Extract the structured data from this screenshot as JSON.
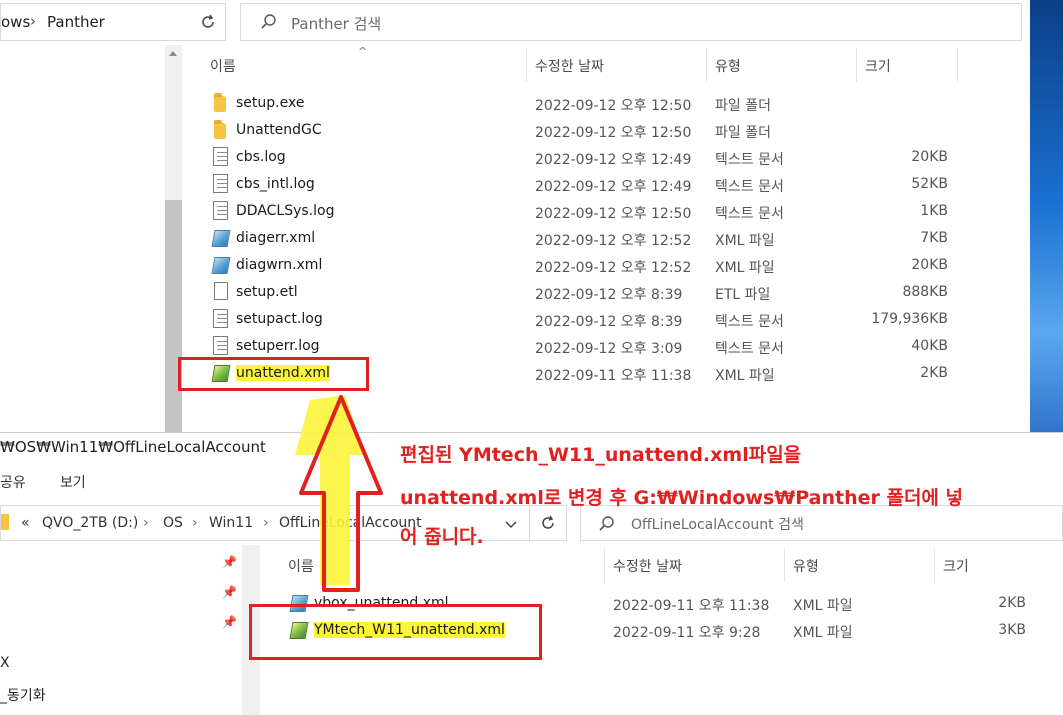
{
  "top_window": {
    "address": {
      "tail": "ows",
      "folder": "Panther"
    },
    "search_placeholder": "Panther 검색",
    "columns": {
      "name": "이름",
      "date": "수정한 날짜",
      "type": "유형",
      "size": "크기"
    },
    "files": [
      {
        "name": "setup.exe",
        "date": "2022-09-12 오후 12:50",
        "type": "파일 폴더",
        "size": "",
        "icon": "folder-icon"
      },
      {
        "name": "UnattendGC",
        "date": "2022-09-12 오후 12:50",
        "type": "파일 폴더",
        "size": "",
        "icon": "folder-icon"
      },
      {
        "name": "cbs.log",
        "date": "2022-09-12 오후 12:49",
        "type": "텍스트 문서",
        "size": "20KB",
        "icon": "text-file-icon"
      },
      {
        "name": "cbs_intl.log",
        "date": "2022-09-12 오후 12:49",
        "type": "텍스트 문서",
        "size": "52KB",
        "icon": "text-file-icon"
      },
      {
        "name": "DDACLSys.log",
        "date": "2022-09-12 오후 12:50",
        "type": "텍스트 문서",
        "size": "1KB",
        "icon": "text-file-icon"
      },
      {
        "name": "diagerr.xml",
        "date": "2022-09-12 오후 12:52",
        "type": "XML 파일",
        "size": "7KB",
        "icon": "xml-file-icon"
      },
      {
        "name": "diagwrn.xml",
        "date": "2022-09-12 오후 12:52",
        "type": "XML 파일",
        "size": "20KB",
        "icon": "xml-file-icon"
      },
      {
        "name": "setup.etl",
        "date": "2022-09-12 오후 8:39",
        "type": "ETL 파일",
        "size": "888KB",
        "icon": "blank-file-icon"
      },
      {
        "name": "setupact.log",
        "date": "2022-09-12 오후 8:39",
        "type": "텍스트 문서",
        "size": "179,936KB",
        "icon": "text-file-icon"
      },
      {
        "name": "setuperr.log",
        "date": "2022-09-12 오후 3:09",
        "type": "텍스트 문서",
        "size": "40KB",
        "icon": "text-file-icon"
      },
      {
        "name": "unattend.xml",
        "date": "2022-09-11 오후 11:38",
        "type": "XML 파일",
        "size": "2KB",
        "icon": "xml-file-icon"
      }
    ]
  },
  "bottom_window": {
    "title": "₩OS₩Win11₩OffLineLocalAccount",
    "menu": {
      "share": "공유",
      "view": "보기"
    },
    "breadcrumb": [
      "«",
      "QVO_2TB (D:)",
      "OS",
      "Win11",
      "OffLineLocalAccount"
    ],
    "search_placeholder": "OffLineLocalAccount 검색",
    "nav_items": [
      "X",
      "_동기화"
    ],
    "columns": {
      "name": "이름",
      "date": "수정한 날짜",
      "type": "유형",
      "size": "크기"
    },
    "files": [
      {
        "name": "vbox_unattend.xml",
        "date": "2022-09-11 오후 11:38",
        "type": "XML 파일",
        "size": "2KB",
        "icon": "xml-file-icon"
      },
      {
        "name": "YMtech_W11_unattend.xml",
        "date": "2022-09-11 오후 9:28",
        "type": "XML 파일",
        "size": "3KB",
        "icon": "xml-file-icon"
      }
    ]
  },
  "annotation": {
    "line1": "편집된 YMtech_W11_unattend.xml파일을",
    "line2": "unattend.xml로 변경 후 G:₩Windows₩Panther 폴더에 넣",
    "line3": "어 줍니다."
  },
  "colors": {
    "highlight": "#fbf43b",
    "annotation_red": "#e32020"
  }
}
